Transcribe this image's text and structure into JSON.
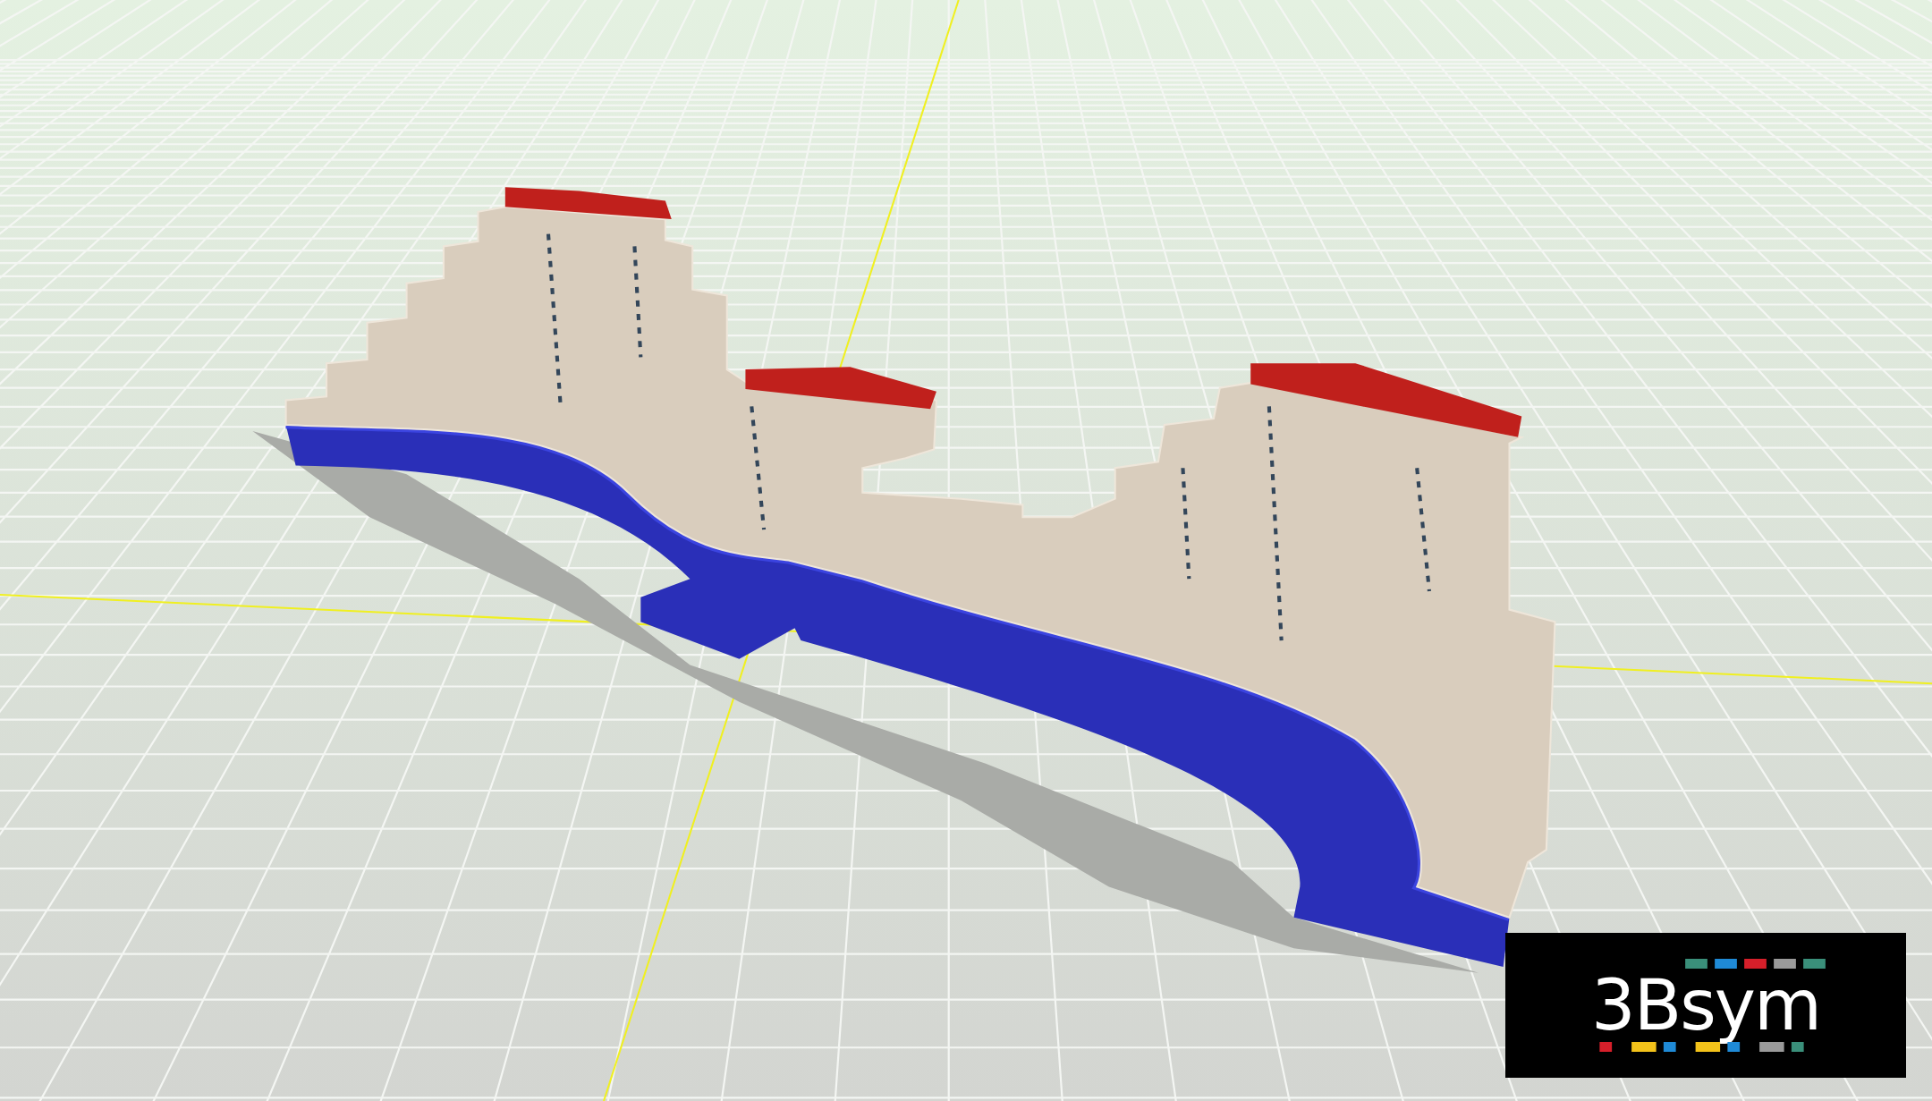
{
  "logo": {
    "text": "3Bsym"
  }
}
